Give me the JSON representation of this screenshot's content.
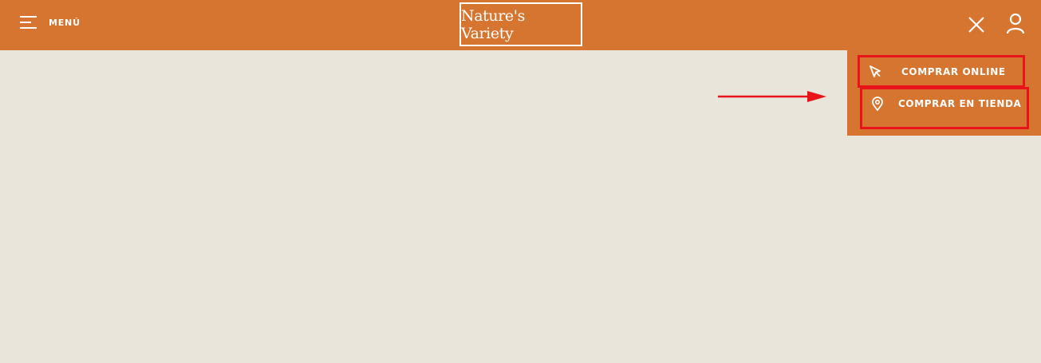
{
  "header": {
    "menu_label": "MENÚ",
    "logo_text": "Nature's Variety",
    "icons": [
      "hamburger-icon",
      "close-icon",
      "user-icon"
    ]
  },
  "dropdown": {
    "items": [
      {
        "label": "COMPRAR ONLINE",
        "icon": "cursor-icon"
      },
      {
        "label": "COMPRAR EN TIENDA",
        "icon": "location-pin-icon"
      }
    ]
  },
  "annotation": {
    "icon": "arrow-right-icon"
  },
  "colors": {
    "brand_orange": "#d67530",
    "page_background": "#e9e5db",
    "highlight_red": "#e8141a",
    "text_white": "#ffffff"
  }
}
